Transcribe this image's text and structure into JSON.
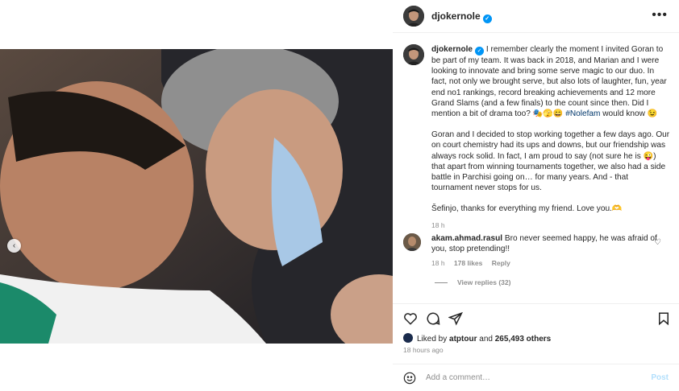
{
  "post": {
    "username": "djokernole",
    "more_icon": "more-horizontal-icon"
  },
  "caption": {
    "username": "djokernole",
    "para1": "I remember clearly the moment I invited Goran to be part of my team. It was back in 2018, and Marian and I were looking to innovate and bring some serve magic to our duo. In fact, not only we brought serve, but also lots of laughter, fun, year end no1 rankings, record breaking achievements and 12 more Grand Slams (and a few finals) to the count since then. Did I mention a bit of drama too? 🎭🫣😄 ",
    "hashtag": "#Nolefam",
    "para1_end": " would know 😉",
    "para2": "Goran and I decided to stop working together a few days ago. Our on court chemistry had its ups and downs, but our friendship was always rock solid. In fact, I am proud to say (not sure he is 😜) that apart from winning tournaments together, we also had a side battle in Parchisi going on… for many years. And - that tournament never stops for us.",
    "para3": "Šefinjo, thanks for everything my friend. Love you.🫶",
    "time": "18 h"
  },
  "comment": {
    "username": "akam.ahmad.rasul",
    "text": "Bro never seemed happy, he was afraid of you, stop pretending!!",
    "time": "18 h",
    "likes": "178 likes",
    "reply": "Reply",
    "view_replies": "View replies (32)"
  },
  "likes": {
    "prefix": "Liked by ",
    "user": "atptour",
    "and": " and ",
    "count": "265,493 others"
  },
  "timestamp": "18 hours ago",
  "add_comment": {
    "placeholder": "Add a comment…",
    "post_label": "Post"
  },
  "colors": {
    "verified": "#0095f6",
    "hashtag": "#00376b",
    "post_button": "#b2dffc",
    "muted": "#8e8e8e"
  }
}
